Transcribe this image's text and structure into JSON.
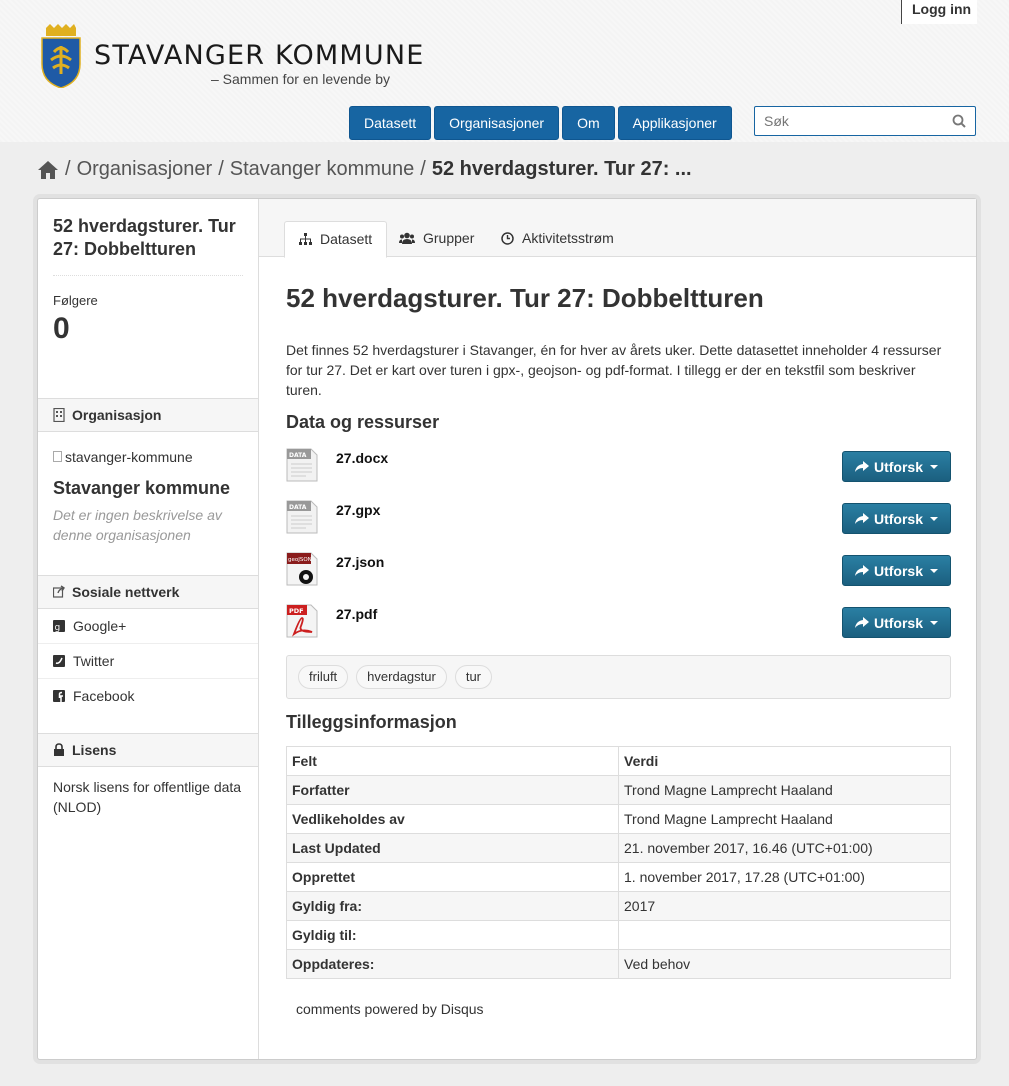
{
  "header": {
    "login_label": "Logg inn",
    "brand_title": "STAVANGER KOMMUNE",
    "brand_tagline": "– Sammen for en levende by",
    "nav": [
      "Datasett",
      "Organisasjoner",
      "Om",
      "Applikasjoner"
    ],
    "search_placeholder": "Søk",
    "colors": {
      "nav": "#1765a2",
      "explore": "#1e6a8c"
    }
  },
  "breadcrumb": {
    "items": [
      "Organisasjoner",
      "Stavanger kommune"
    ],
    "current": "52 hverdagsturer. Tur 27: ...",
    "separator": "/"
  },
  "sidebar": {
    "title": "52 hverdagsturer. Tur 27: Dobbeltturen",
    "followers_label": "Følgere",
    "followers_value": "0",
    "org_heading": "Organisasjon",
    "org_image_alt": "stavanger-kommune",
    "org_name": "Stavanger kommune",
    "org_description": "Det er ingen beskrivelse av denne organisasjonen",
    "social_heading": "Sosiale nettverk",
    "social": [
      "Google+",
      "Twitter",
      "Facebook"
    ],
    "license_heading": "Lisens",
    "license_text": "Norsk lisens for offentlige data (NLOD)"
  },
  "tabs": [
    "Datasett",
    "Grupper",
    "Aktivitetsstrøm"
  ],
  "dataset": {
    "title": "52 hverdagsturer. Tur 27: Dobbeltturen",
    "description": "Det finnes 52 hverdagsturer i Stavanger, én for hver av årets uker. Dette datasettet inneholder 4 ressurser for tur 27. Det er kart over turen i gpx-, geojson- og pdf-format. I tillegg er der en tekstfil som beskriver turen.",
    "resources_heading": "Data og ressurser",
    "resources": [
      {
        "name": "27.docx",
        "icon": "data-file-icon",
        "icon_text": "DATA"
      },
      {
        "name": "27.gpx",
        "icon": "data-file-icon",
        "icon_text": "DATA"
      },
      {
        "name": "27.json",
        "icon": "geojson-file-icon",
        "icon_text": "geoJSON"
      },
      {
        "name": "27.pdf",
        "icon": "pdf-file-icon",
        "icon_text": "PDF"
      }
    ],
    "explore_label": "Utforsk",
    "tags": [
      "friluft",
      "hverdagstur",
      "tur"
    ],
    "additional_heading": "Tilleggsinformasjon",
    "table_headers": [
      "Felt",
      "Verdi"
    ],
    "table_rows": [
      [
        "Forfatter",
        "Trond Magne Lamprecht Haaland"
      ],
      [
        "Vedlikeholdes av",
        "Trond Magne Lamprecht Haaland"
      ],
      [
        "Last Updated",
        "21. november 2017, 16.46 (UTC+01:00)"
      ],
      [
        "Opprettet",
        "1. november 2017, 17.28 (UTC+01:00)"
      ],
      [
        "Gyldig fra:",
        "2017"
      ],
      [
        "Gyldig til:",
        ""
      ],
      [
        "Oppdateres:",
        "Ved behov"
      ]
    ],
    "disqus_text": "comments powered by Disqus"
  }
}
